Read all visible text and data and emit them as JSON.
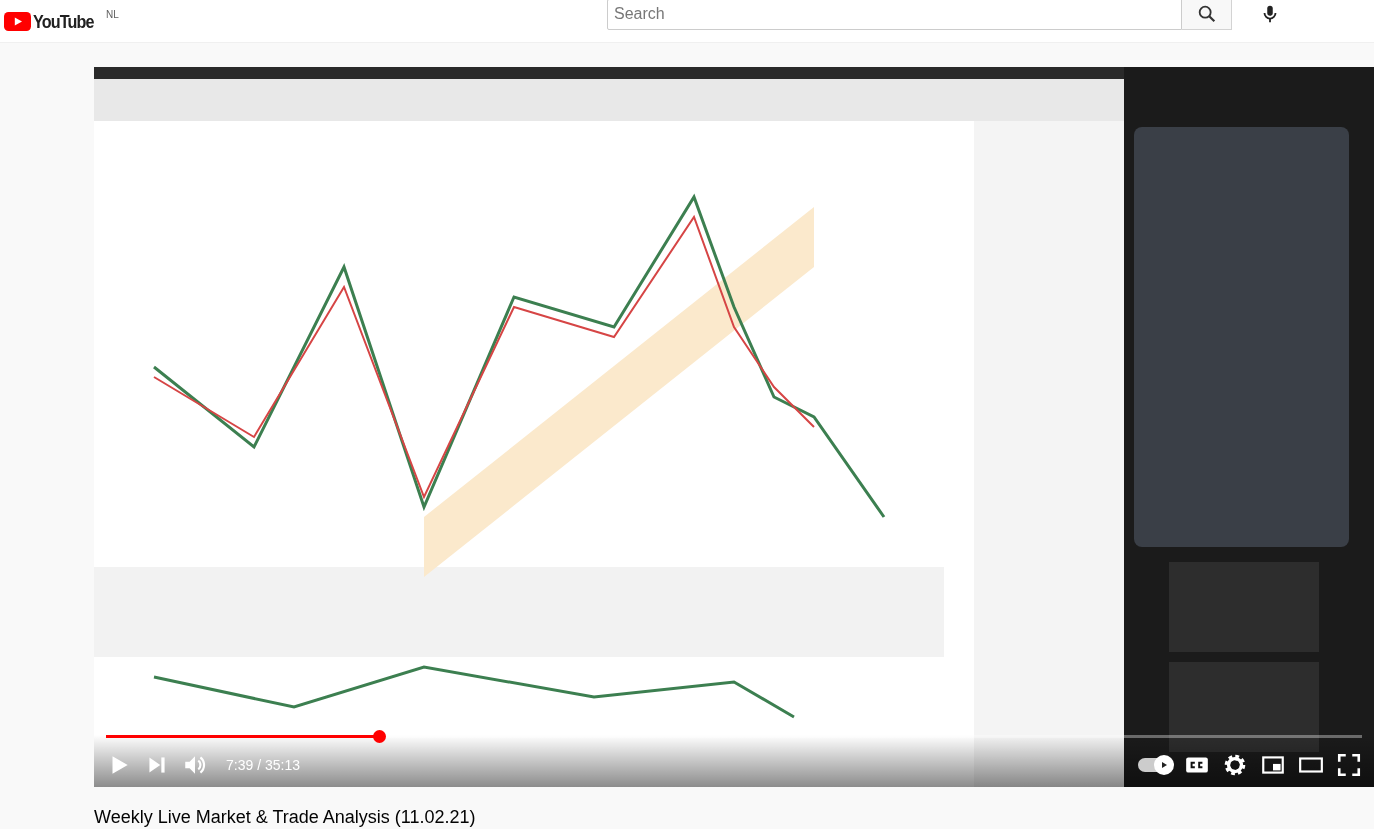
{
  "header": {
    "logo_text": "YouTube",
    "logo_region": "NL",
    "search": {
      "placeholder": "Search"
    }
  },
  "player": {
    "progress": {
      "level": 0.217
    },
    "time": "7:39 / 35:13",
    "autoplay": {
      "on": true
    }
  },
  "video_title": "Weekly Live Market & Trade Analysis (11.02.21)"
}
